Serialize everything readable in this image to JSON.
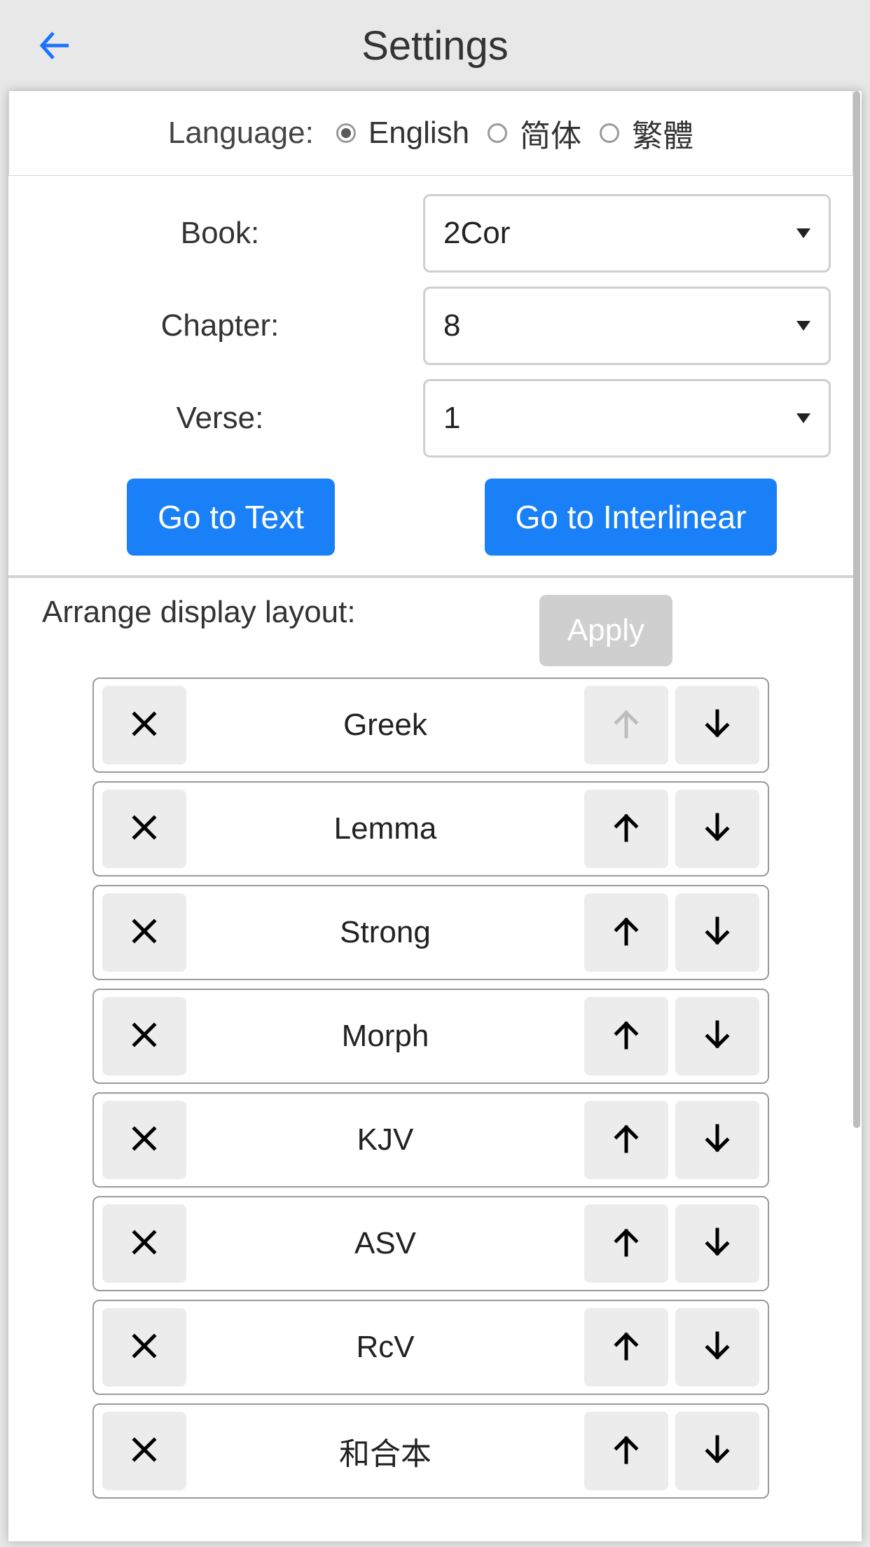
{
  "header": {
    "title": "Settings"
  },
  "language": {
    "label": "Language:",
    "options": [
      "English",
      "简体",
      "繁體"
    ],
    "selected": 0
  },
  "pickers": {
    "book": {
      "label": "Book:",
      "value": "2Cor"
    },
    "chapter": {
      "label": "Chapter:",
      "value": "8"
    },
    "verse": {
      "label": "Verse:",
      "value": "1"
    }
  },
  "buttons": {
    "go_text": "Go to Text",
    "go_interlinear": "Go to Interlinear"
  },
  "arrange": {
    "label": "Arrange display layout:",
    "apply": "Apply",
    "items": [
      {
        "label": "Greek",
        "up_disabled": true
      },
      {
        "label": "Lemma",
        "up_disabled": false
      },
      {
        "label": "Strong",
        "up_disabled": false
      },
      {
        "label": "Morph",
        "up_disabled": false
      },
      {
        "label": "KJV",
        "up_disabled": false
      },
      {
        "label": "ASV",
        "up_disabled": false
      },
      {
        "label": "RcV",
        "up_disabled": false
      },
      {
        "label": "和合本",
        "up_disabled": false
      }
    ]
  }
}
